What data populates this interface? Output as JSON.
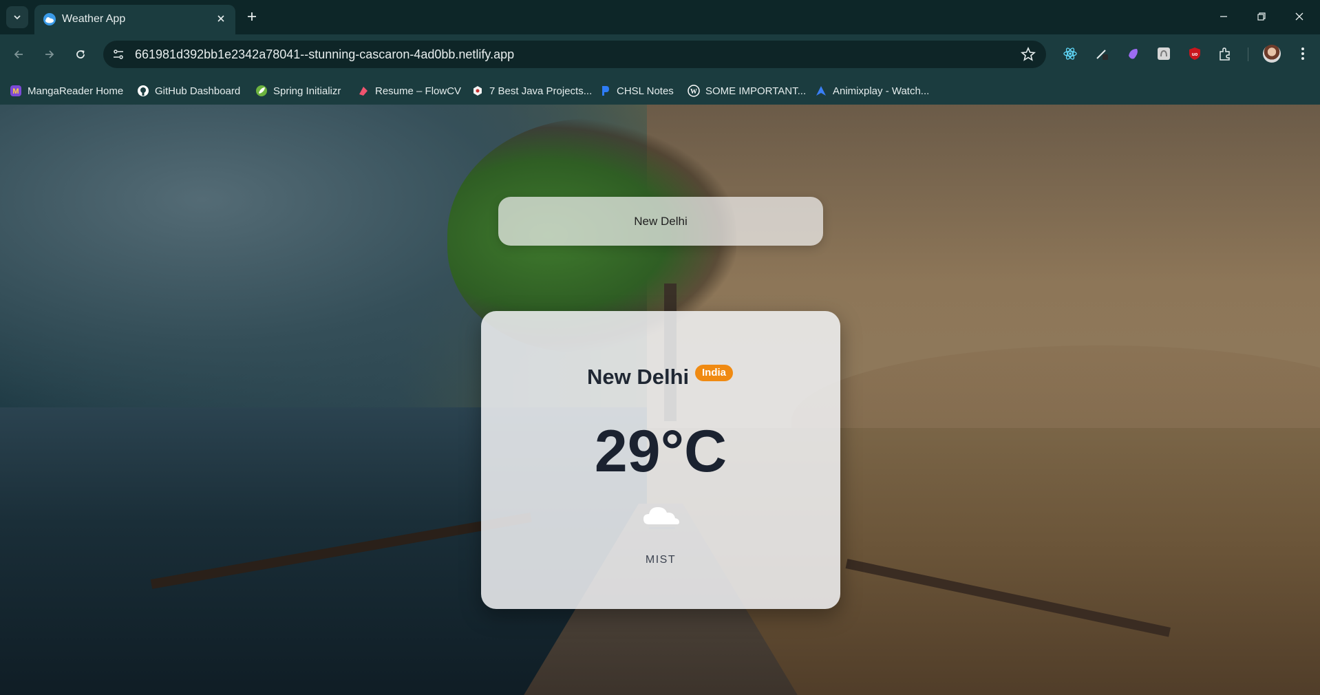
{
  "browser": {
    "tab": {
      "title": "Weather App"
    },
    "address_bar": {
      "url": "661981d392bb1e2342a78041--stunning-cascaron-4ad0bb.netlify.app"
    },
    "bookmarks": [
      {
        "label": "MangaReader Home",
        "icon": "mangareader-icon"
      },
      {
        "label": "GitHub Dashboard",
        "icon": "github-icon"
      },
      {
        "label": "Spring Initializr",
        "icon": "spring-icon"
      },
      {
        "label": "Resume – FlowCV",
        "icon": "flowcv-icon"
      },
      {
        "label": "7 Best Java Projects...",
        "icon": "hexagon-icon"
      },
      {
        "label": "CHSL Notes",
        "icon": "p-icon"
      },
      {
        "label": "SOME IMPORTANT...",
        "icon": "wordpress-icon"
      },
      {
        "label": "Animixplay - Watch...",
        "icon": "animixplay-icon"
      }
    ],
    "extensions": [
      "react-devtools-icon",
      "pen-extension-icon",
      "purple-extension-icon",
      "puzzle-tile-icon",
      "ublock-origin-icon",
      "extensions-icon"
    ]
  },
  "weather": {
    "search_value": "New Delhi",
    "city": "New Delhi",
    "country": "India",
    "temperature": "29°C",
    "condition": "MIST",
    "condition_icon": "cloud-mist-icon"
  },
  "colors": {
    "badge": "#f08a12",
    "card": "#f1f2f4",
    "chrome": "#1b3c3f"
  }
}
